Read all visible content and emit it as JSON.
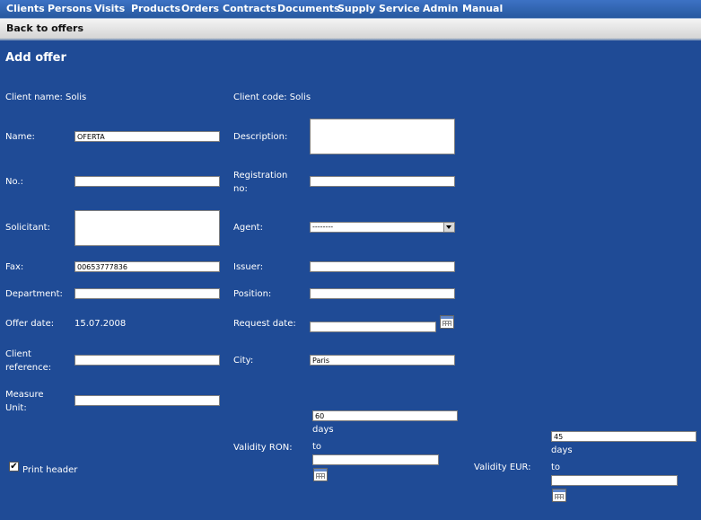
{
  "nav": {
    "items": [
      "Clients",
      "Persons",
      "Visits",
      "Products",
      "Orders",
      "Contracts",
      "Documents",
      "Supply",
      "Service",
      "Admin",
      "Manual"
    ]
  },
  "subnav": {
    "back_label": "Back to offers"
  },
  "page_title": "Add offer",
  "form": {
    "client_name_label": "Client name: Solis",
    "client_code_label": "Client code: Solis",
    "name_label": "Name:",
    "name_value": "OFERTA",
    "description_label": "Description:",
    "no_label": "No.:",
    "no_value": "",
    "registration_label_1": "Registration",
    "registration_label_2": "no:",
    "registration_value": "",
    "solicitant_label": "Solicitant:",
    "agent_label": "Agent:",
    "agent_selected": "--------",
    "fax_label": "Fax:",
    "fax_value": "00653777836",
    "issuer_label": "Issuer:",
    "issuer_value": "",
    "department_label": "Department:",
    "department_value": "",
    "position_label": "Position:",
    "position_value": "",
    "offer_date_label": "Offer date:",
    "offer_date_value": "15.07.2008",
    "request_date_label": "Request date:",
    "request_date_value": "",
    "client_reference_label_1": "Client",
    "client_reference_label_2": "reference:",
    "client_reference_value": "",
    "city_label": "City:",
    "city_value": "Paris",
    "measure_unit_label_1": "Measure",
    "measure_unit_label_2": "Unit:",
    "measure_unit_value": "",
    "validity_ron_label": "Validity RON:",
    "validity_ron_days": "60",
    "validity_ron_date": "",
    "days_label": "days",
    "to_label": "to",
    "validity_eur_label": "Validity EUR:",
    "validity_eur_days": "45",
    "validity_eur_date": "",
    "print_header_label": "Print header"
  }
}
